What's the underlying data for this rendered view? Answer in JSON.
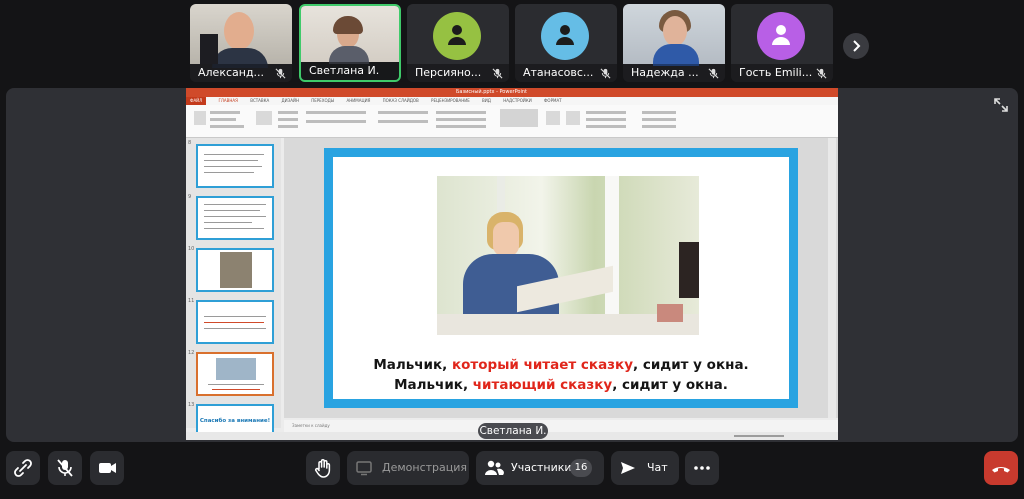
{
  "participants": [
    {
      "name": "Александ...",
      "type": "video"
    },
    {
      "name": "Светлана И.",
      "type": "video",
      "active": true
    },
    {
      "name": "Персияно...",
      "type": "avatar",
      "color": "#96c142"
    },
    {
      "name": "Атанасовс...",
      "type": "avatar",
      "color": "#65bde6"
    },
    {
      "name": "Надежда ...",
      "type": "video"
    },
    {
      "name": "Гость Emili...",
      "type": "avatar",
      "color": "#b85fe6"
    }
  ],
  "icons": {
    "mic_off": "mic-off-icon",
    "next": "chevron-right-icon",
    "expand": "expand-icon",
    "link": "link-icon",
    "camera": "camera-icon",
    "hand": "raise-hand-icon",
    "screen": "screen-share-icon",
    "people": "participants-icon",
    "chat": "chat-icon",
    "more": "more-icon",
    "hangup": "hang-up-icon"
  },
  "presentation": {
    "window_title": "Базисный.pptx - PowerPoint",
    "file_tab": "ФАЙЛ",
    "ribbon_tabs": [
      "ГЛАВНАЯ",
      "ВСТАВКА",
      "ДИЗАЙН",
      "ПЕРЕХОДЫ",
      "АНИМАЦИЯ",
      "ПОКАЗ СЛАЙДОВ",
      "РЕЦЕНЗИРОВАНИЕ",
      "ВИД",
      "НАДСТРОЙКИ",
      "ФОРМАТ"
    ],
    "thumb_numbers": [
      "8",
      "9",
      "10",
      "11",
      "12",
      "13"
    ],
    "thumb_last_text": "Спасибо за внимание!",
    "slide_line1": {
      "before": "Мальчик, ",
      "highlight": "который читает сказку",
      "after": ", сидит у окна."
    },
    "slide_line2": {
      "before": "Мальчик, ",
      "highlight": "читающий сказку",
      "after": ", сидит у окна."
    },
    "notes_placeholder": "Заметки к слайду"
  },
  "speaker_label": "Светлана И.",
  "toolbar": {
    "demo_label": "Демонстрация",
    "participants_label": "Участники",
    "participants_count": "16",
    "chat_label": "Чат"
  },
  "colors": {
    "accent_active": "#3fca6a",
    "slide_frame": "#29a3e1",
    "highlight_text": "#e0261b",
    "hangup": "#c83a2e"
  }
}
